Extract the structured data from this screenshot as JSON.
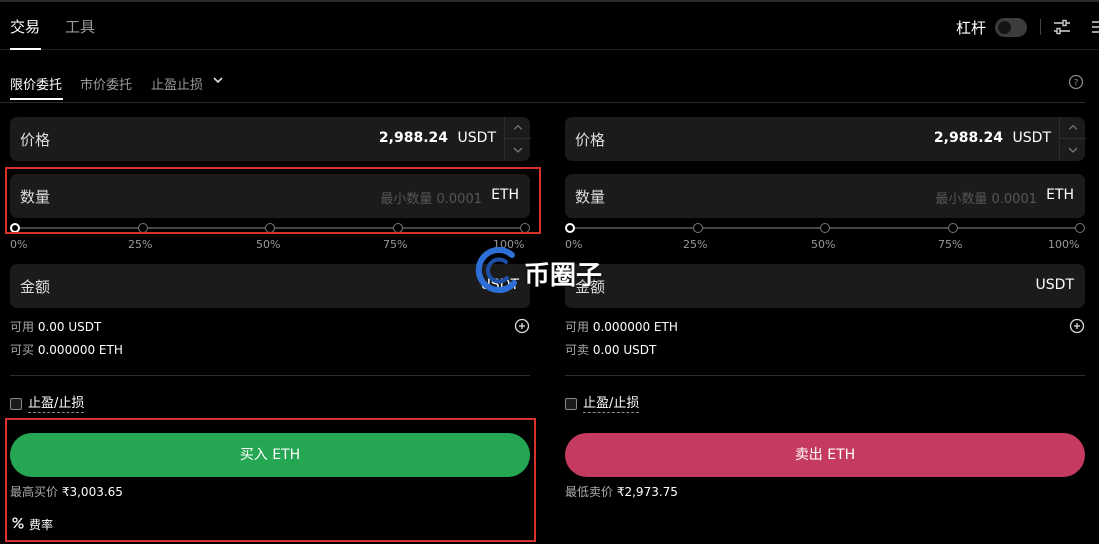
{
  "topbar": {
    "tabs": [
      {
        "label": "交易"
      },
      {
        "label": "工具"
      }
    ],
    "leverage_label": "杠杆"
  },
  "order_tabs": [
    {
      "label": "限价委托"
    },
    {
      "label": "市价委托"
    },
    {
      "label": "止盈止损"
    }
  ],
  "buy": {
    "price": {
      "label": "价格",
      "value": "2,988.24",
      "unit": "USDT"
    },
    "amount": {
      "label": "数量",
      "placeholder": "最小数量 0.0001",
      "unit": "ETH"
    },
    "slider": {
      "ticks": [
        "0%",
        "25%",
        "50%",
        "75%",
        "100%"
      ],
      "value": 0
    },
    "total": {
      "label": "金额",
      "unit": "USDT"
    },
    "available": {
      "label": "可用",
      "value": "0.00 USDT"
    },
    "can_trade": {
      "label": "可买",
      "value": "0.000000 ETH"
    },
    "tpsl_label": "止盈/止损",
    "button_label": "买入 ETH",
    "limit_price": {
      "label": "最高买价",
      "value": "₹3,003.65"
    },
    "fee_label": "费率"
  },
  "sell": {
    "price": {
      "label": "价格",
      "value": "2,988.24",
      "unit": "USDT"
    },
    "amount": {
      "label": "数量",
      "placeholder": "最小数量 0.0001",
      "unit": "ETH"
    },
    "slider": {
      "ticks": [
        "0%",
        "25%",
        "50%",
        "75%",
        "100%"
      ],
      "value": 0
    },
    "total": {
      "label": "金额",
      "unit": "USDT"
    },
    "available": {
      "label": "可用",
      "value": "0.000000 ETH"
    },
    "can_trade": {
      "label": "可卖",
      "value": "0.00 USDT"
    },
    "tpsl_label": "止盈/止损",
    "button_label": "卖出 ETH",
    "limit_price": {
      "label": "最低卖价",
      "value": "₹2,973.75"
    }
  },
  "watermark": {
    "text": "币圈子"
  },
  "colors": {
    "buy": "#24a652",
    "sell": "#c53b5f",
    "highlight": "#d8332b"
  }
}
